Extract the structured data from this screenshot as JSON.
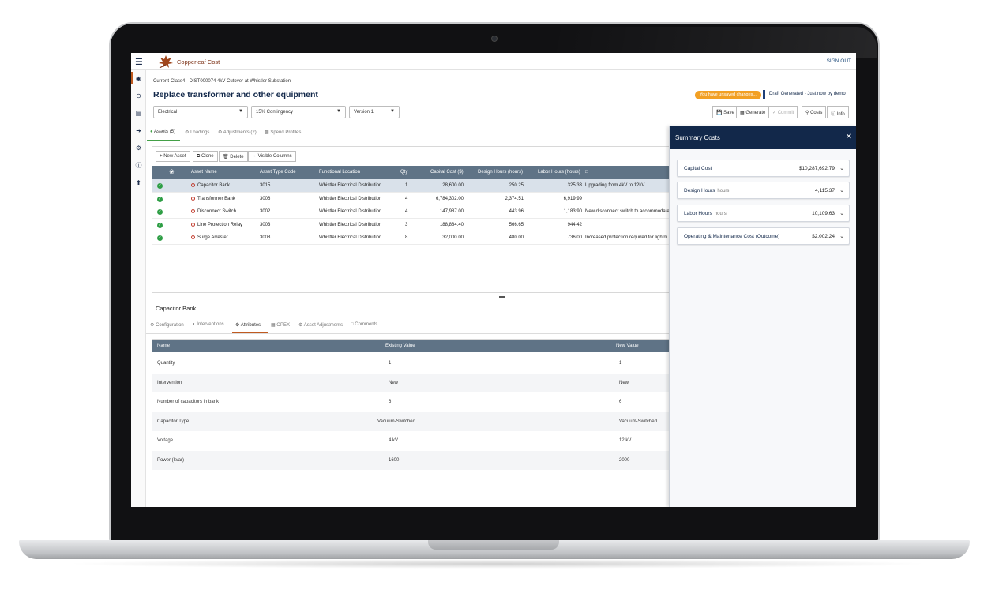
{
  "app": {
    "name": "Copperleaf Cost",
    "sign_out": "SIGN OUT"
  },
  "breadcrumb": "Current-Class4 - DIST000074 4kV Cutover at Whistler Substation",
  "title": "Replace transformer and other equipment",
  "selects": {
    "category": "Electrical",
    "contingency": "15% Contingency",
    "version": "Version 1"
  },
  "status": {
    "unsaved": "You have unsaved changes...",
    "draft": "Draft Generated - Just now by demo"
  },
  "toolbar": {
    "save": "Save",
    "generate": "Generate",
    "commit": "Commit",
    "costs": "Costs",
    "info": "Info"
  },
  "tabs": {
    "assets": "Assets (5)",
    "loadings": "Loadings",
    "adjustments": "Adjustments (2)",
    "spend_profiles": "Spend Profiles"
  },
  "grid_buttons": {
    "new_asset": "New Asset",
    "clone": "Clone",
    "delete": "Delete",
    "visible_columns": "Visible Columns"
  },
  "grid": {
    "headers": {
      "asset_name": "Asset Name",
      "asset_type_code": "Asset Type Code",
      "functional_location": "Functional Location",
      "qty": "Qty",
      "capital_cost": "Capital Cost ($)",
      "design_hours": "Design Hours (hours)",
      "labor_hours": "Labor Hours (hours)"
    },
    "rows": [
      {
        "name": "Capacitor Bank",
        "code": "3015",
        "location": "Whistler Electrical Distribution",
        "qty": "1",
        "capital": "28,600.00",
        "design": "250.25",
        "labor": "325.33",
        "comment": "Upgrading from 4kV to 12kV."
      },
      {
        "name": "Transformer Bank",
        "code": "3006",
        "location": "Whistler Electrical Distribution",
        "qty": "4",
        "capital": "6,784,302.00",
        "design": "2,374.51",
        "labor": "6,919.99",
        "comment": ""
      },
      {
        "name": "Disconnect Switch",
        "code": "3002",
        "location": "Whistler Electrical Distribution",
        "qty": "4",
        "capital": "147,987.00",
        "design": "443.96",
        "labor": "1,183.90",
        "comment": "New disconnect switch to accommodate"
      },
      {
        "name": "Line Protection Relay",
        "code": "3003",
        "location": "Whistler Electrical Distribution",
        "qty": "3",
        "capital": "188,884.40",
        "design": "566.65",
        "labor": "944.42",
        "comment": ""
      },
      {
        "name": "Surge Arrester",
        "code": "3008",
        "location": "Whistler Electrical Distribution",
        "qty": "8",
        "capital": "32,000.00",
        "design": "480.00",
        "labor": "736.00",
        "comment": "Increased protection required for lightni"
      }
    ]
  },
  "detail": {
    "title": "Capacitor Bank",
    "tabs": {
      "configuration": "Configuration",
      "interventions": "Interventions",
      "attributes": "Attributes",
      "opex": "OPEX",
      "asset_adjustments": "Asset Adjustments",
      "comments": "Comments"
    },
    "headers": {
      "name": "Name",
      "existing": "Existing Value",
      "new": "New Value"
    },
    "rows": [
      {
        "name": "Quantity",
        "existing": "1",
        "new": "1"
      },
      {
        "name": "Intervention",
        "existing": "New",
        "new": "New"
      },
      {
        "name": "Number of capacitors in bank",
        "existing": "6",
        "new": "6"
      },
      {
        "name": "Capacitor Type",
        "existing": "Vacuum-Switched",
        "new": "Vacuum-Switched"
      },
      {
        "name": "Voltage",
        "existing": "4 kV",
        "new": "12 kV"
      },
      {
        "name": "Power (kvar)",
        "existing": "1600",
        "new": "2000"
      }
    ]
  },
  "summary": {
    "title": "Summary Costs",
    "cards": [
      {
        "label": "Capital Cost",
        "unit": "",
        "value": "$10,287,692.79"
      },
      {
        "label": "Design Hours",
        "unit": "hours",
        "value": "4,115.37"
      },
      {
        "label": "Labor Hours",
        "unit": "hours",
        "value": "10,109.63"
      },
      {
        "label": "Operating & Maintenance Cost (Outcome)",
        "unit": "",
        "value": "$2,002.24"
      }
    ]
  },
  "colors": {
    "navy": "#12284a",
    "grid_header": "#5f7386",
    "unsaved": "#f2a024",
    "success": "#2e9e45",
    "accent": "#c05a20"
  }
}
